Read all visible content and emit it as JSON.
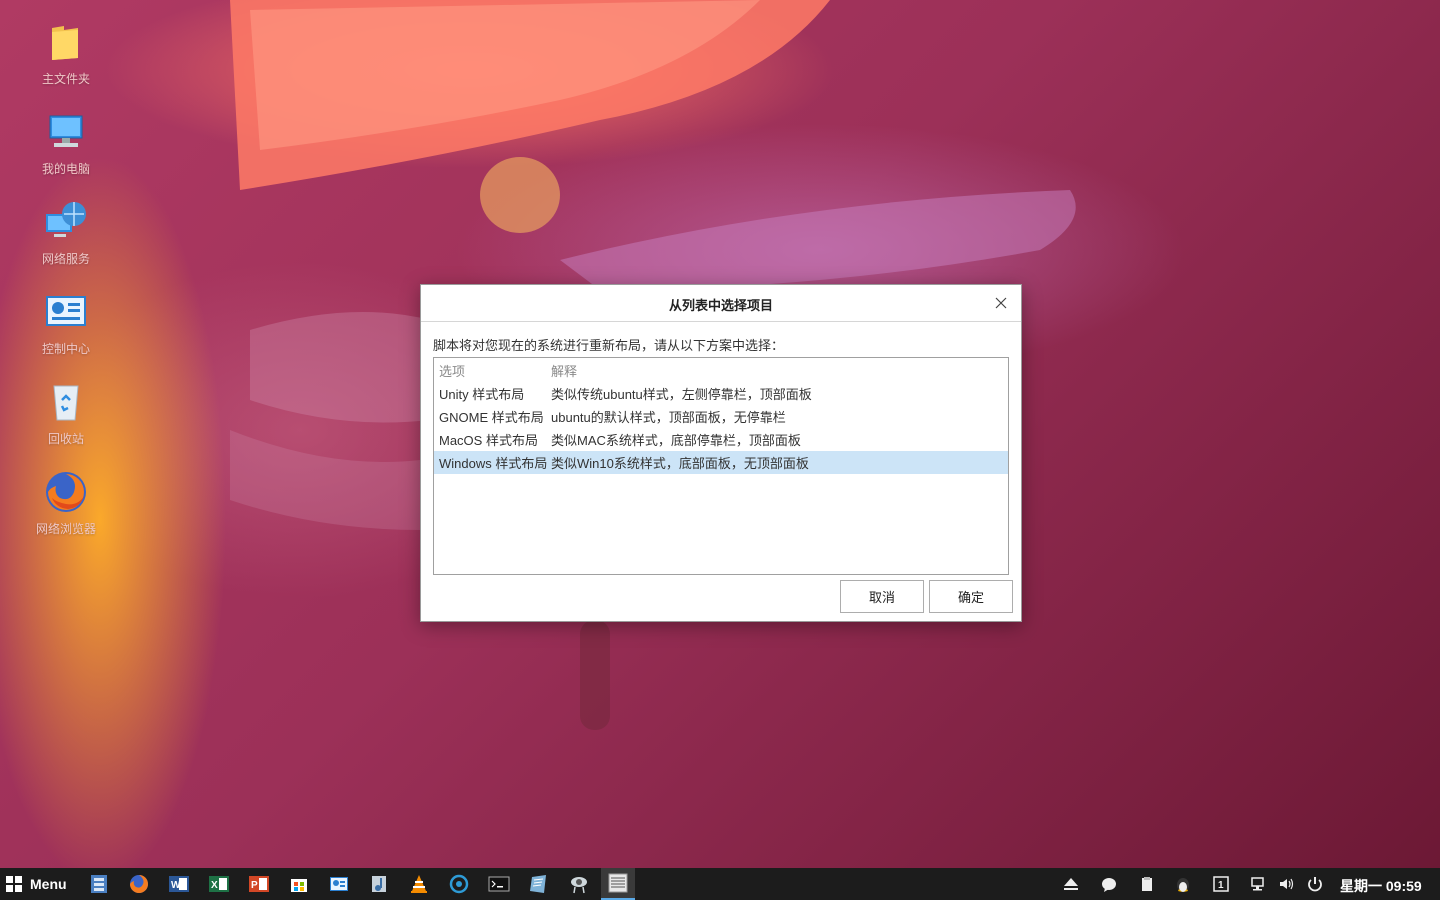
{
  "desktop": {
    "icons": [
      {
        "label": "主文件夹",
        "icon": "folder-icon"
      },
      {
        "label": "我的电脑",
        "icon": "computer-icon"
      },
      {
        "label": "网络服务",
        "icon": "network-icon"
      },
      {
        "label": "控制中心",
        "icon": "control-center-icon"
      },
      {
        "label": "回收站",
        "icon": "recycle-bin-icon"
      },
      {
        "label": "网络浏览器",
        "icon": "firefox-icon"
      }
    ]
  },
  "dialog": {
    "title": "从列表中选择项目",
    "prompt": "脚本将对您现在的系统进行重新布局，请从以下方案中选择：",
    "columns": [
      "选项",
      "解释"
    ],
    "rows": [
      {
        "option": "Unity 样式布局",
        "desc": "类似传统ubuntu样式，左侧停靠栏，顶部面板"
      },
      {
        "option": "GNOME 样式布局",
        "desc": "ubuntu的默认样式，顶部面板，无停靠栏"
      },
      {
        "option": "MacOS 样式布局",
        "desc": "类似MAC系统样式，底部停靠栏，顶部面板"
      },
      {
        "option": "Windows 样式布局",
        "desc": "类似Win10系统样式，底部面板，无顶部面板"
      }
    ],
    "selected_row": "Windows 样式布局",
    "cancel_label": "取消",
    "ok_label": "确定"
  },
  "taskbar": {
    "menu_label": "Menu",
    "apps": [
      "file-manager-icon",
      "firefox-icon",
      "word-icon",
      "excel-icon",
      "powerpoint-icon",
      "store-icon",
      "control-panel-icon",
      "music-icon",
      "vlc-icon",
      "circle-app-icon",
      "terminal-icon",
      "text-editor-icon",
      "screenshot-icon",
      "list-window-icon"
    ],
    "active_app": "list-window-icon",
    "tray": [
      "eject-icon",
      "chat-icon",
      "clipboard-icon",
      "tux-icon",
      "workspace-1-icon",
      "network-icon",
      "volume-icon",
      "power-icon"
    ],
    "clock": "星期一 09:59"
  },
  "colors": {
    "selection": "#cce4f7",
    "taskbar": "#1c1c1c",
    "accent": "#5aa9e6"
  }
}
